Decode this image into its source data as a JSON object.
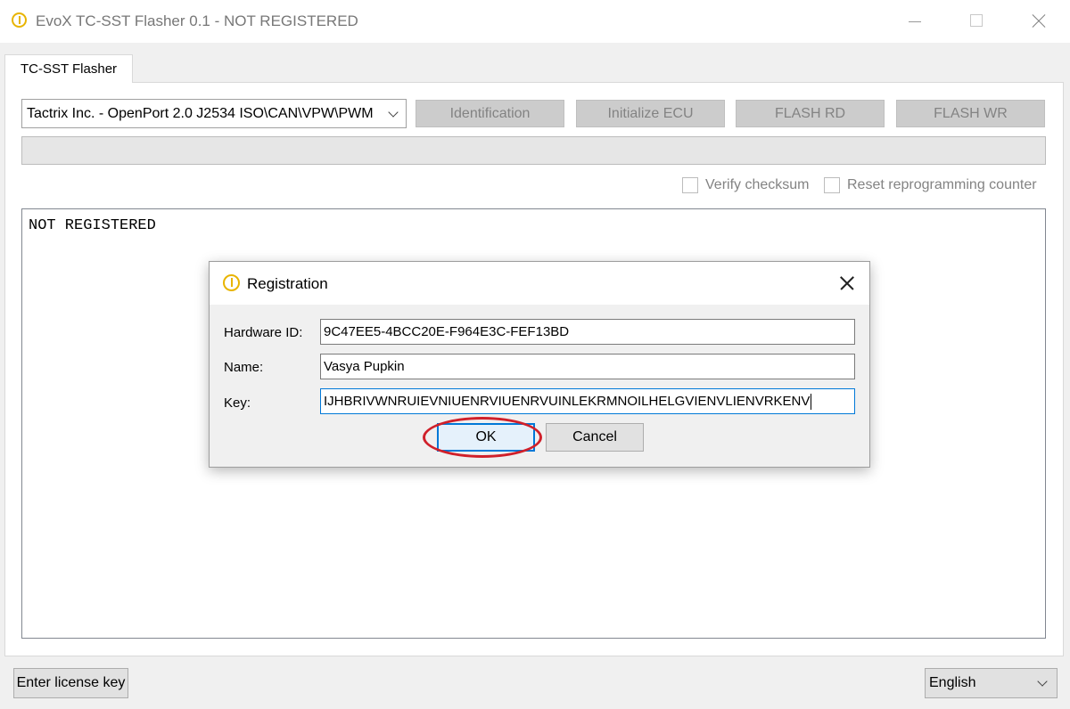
{
  "window": {
    "title": "EvoX TC-SST Flasher 0.1 - NOT REGISTERED",
    "icon": "warning-circle-icon"
  },
  "tabs": [
    {
      "label": "TC-SST Flasher",
      "active": true
    }
  ],
  "device": {
    "selected": "Tactrix Inc. - OpenPort 2.0 J2534 ISO\\CAN\\VPW\\PWM"
  },
  "actions": {
    "identification": "Identification",
    "initialize_ecu": "Initialize ECU",
    "flash_rd": "FLASH RD",
    "flash_wr": "FLASH WR"
  },
  "options": {
    "verify_checksum": {
      "label": "Verify checksum",
      "checked": false
    },
    "reset_counter": {
      "label": "Reset reprogramming counter",
      "checked": false
    }
  },
  "log": {
    "text": "NOT REGISTERED"
  },
  "footer": {
    "license_button": "Enter license key",
    "language": "English"
  },
  "dialog": {
    "title": "Registration",
    "fields": {
      "hardware_id": {
        "label": "Hardware ID:",
        "value": "9C47EE5-4BCC20E-F964E3C-FEF13BD"
      },
      "name": {
        "label": "Name:",
        "value": "Vasya Pupkin"
      },
      "key": {
        "label": "Key:",
        "value": "IJHBRIVWNRUIEVNIUENRVIUENRVUINLEKRMNOILHELGVIENVLIENVRKENV"
      }
    },
    "ok": "OK",
    "cancel": "Cancel"
  },
  "colors": {
    "accent": "#0078d7",
    "highlight": "#d0202a",
    "icon": "#e8b400"
  }
}
